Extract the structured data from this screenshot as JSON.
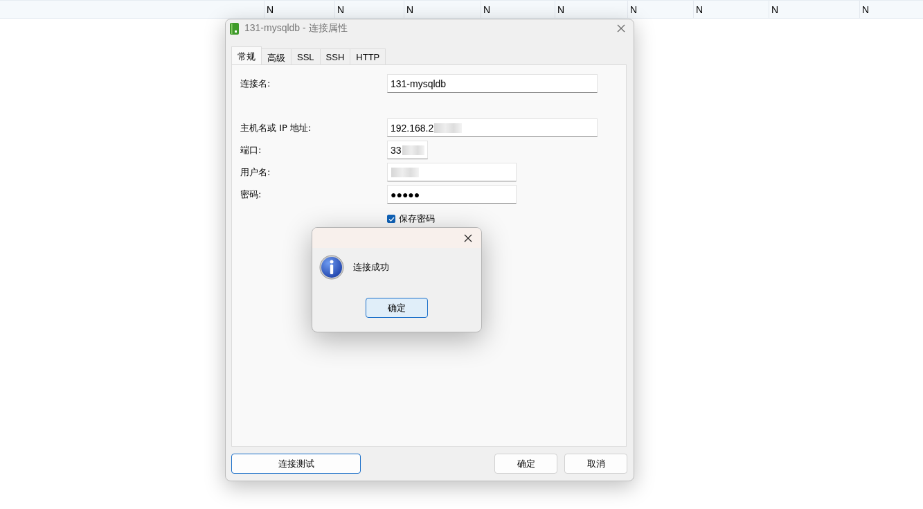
{
  "background_table": {
    "cells": [
      "N",
      "N",
      "N",
      "N",
      "N",
      "N",
      "N",
      "N",
      "N"
    ]
  },
  "dialog": {
    "title": "131-mysqldb - 连接属性",
    "tabs": [
      {
        "label": "常规",
        "selected": true
      },
      {
        "label": "高级",
        "selected": false
      },
      {
        "label": "SSL",
        "selected": false
      },
      {
        "label": "SSH",
        "selected": false
      },
      {
        "label": "HTTP",
        "selected": false
      }
    ],
    "fields": [
      {
        "label": "连接名:",
        "value": "131-mysqldb"
      },
      {
        "label": "主机名或 IP 地址:",
        "value": "192.168.2",
        "masked": true
      },
      {
        "label": "端口:",
        "value": "33",
        "masked": true
      },
      {
        "label": "用户名:",
        "masked": true
      },
      {
        "label": "密码:",
        "value": "●●●●●"
      }
    ],
    "save_password": {
      "label": "保存密码",
      "checked": true
    },
    "buttons": {
      "test": "连接测试",
      "ok": "确定",
      "cancel": "取消"
    }
  },
  "message_box": {
    "message": "连接成功",
    "button": "确定"
  }
}
